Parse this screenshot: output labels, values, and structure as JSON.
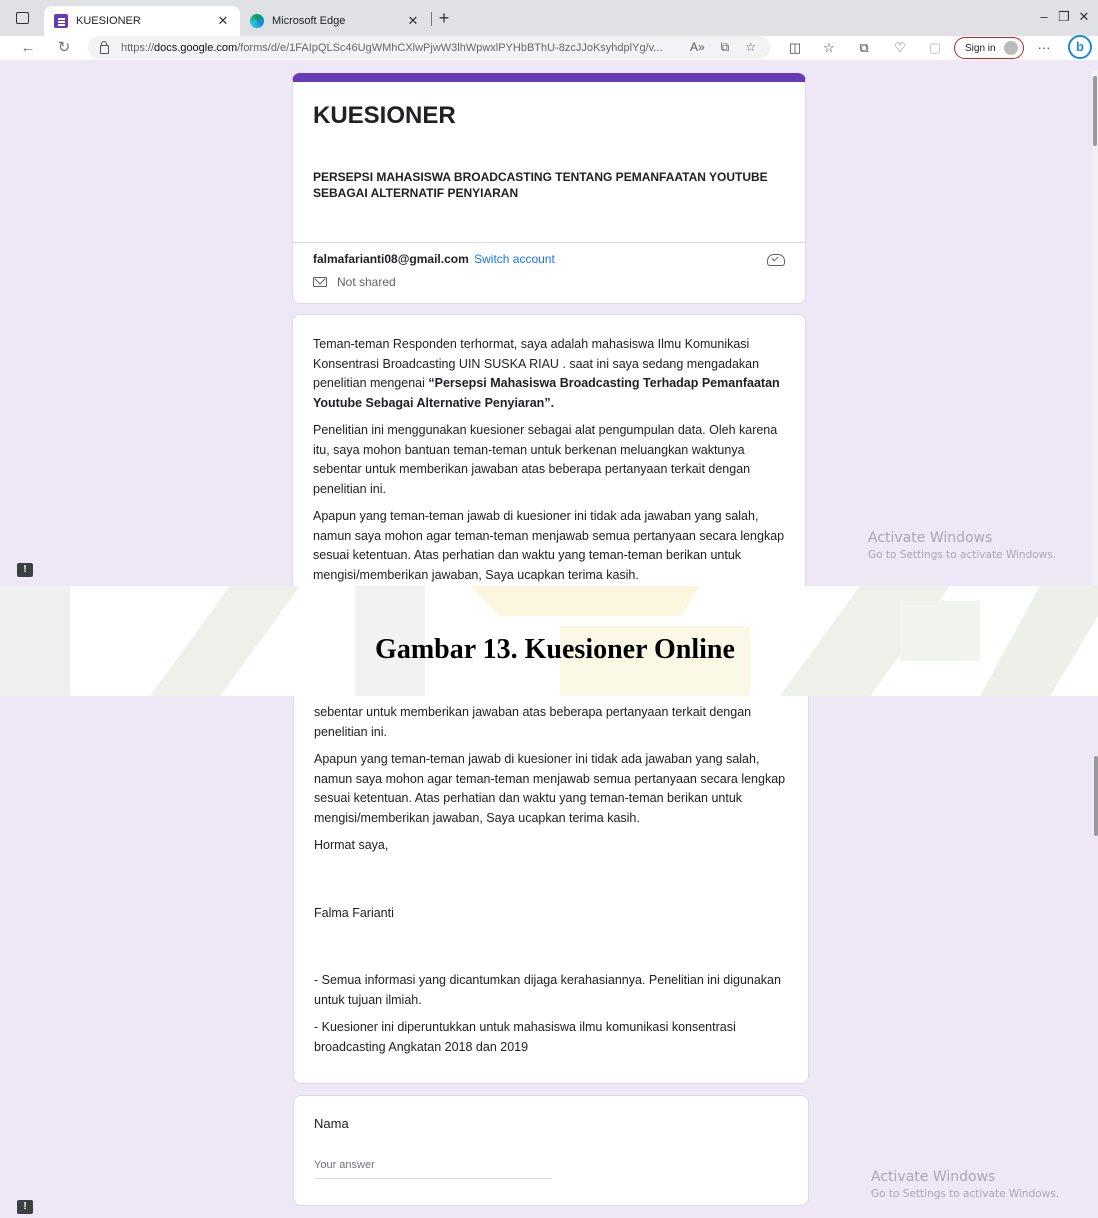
{
  "browser": {
    "tabs": [
      {
        "label": "KUESIONER",
        "close": "✕"
      },
      {
        "label": "Microsoft Edge",
        "close": "✕"
      }
    ],
    "url_prefix": "https://",
    "url_host": "docs.google.com",
    "url_path": "/forms/d/e/1FAIpQLSc46UgWMhCXlwPjwW3lhWpwxlPYHbBThU-8zcJJoKsyhdplYg/v...",
    "sign_in": "Sign in"
  },
  "form": {
    "title": "KUESIONER",
    "subtitle": "PERSEPSI MAHASISWA BROADCASTING TENTANG PEMANFAATAN YOUTUBE SEBAGAI ALTERNATIF PENYIARAN",
    "email": "falmafarianti08@gmail.com",
    "switch_account": "Switch account",
    "not_shared": "Not shared",
    "p1_start": "Teman-teman Responden terhormat, saya adalah mahasiswa Ilmu Komunikasi Konsentrasi Broadcasting UIN SUSKA RIAU . saat ini saya sedang mengadakan penelitian mengenai ",
    "p1_bold": "“Persepsi Mahasiswa Broadcasting Terhadap Pemanfaatan Youtube Sebagai Alternative Penyiaran”.",
    "p2": "Penelitian ini menggunakan kuesioner sebagai alat pengumpulan data. Oleh karena itu, saya mohon bantuan teman-teman untuk berkenan meluangkan waktunya sebentar untuk memberikan jawaban atas beberapa pertanyaan terkait dengan penelitian ini.",
    "p2_tail": "sebentar untuk memberikan jawaban atas beberapa pertanyaan terkait dengan penelitian ini.",
    "p3": "Apapun yang teman-teman jawab di kuesioner ini tidak ada jawaban yang salah, namun saya mohon agar teman-teman menjawab semua pertanyaan secara lengkap sesuai ketentuan. Atas perhatian dan waktu yang teman-teman berikan untuk mengisi/memberikan jawaban, Saya ucapkan terima kasih.",
    "closing": "Hormat saya,",
    "signer": "Falma Farianti",
    "note1": "- Semua informasi yang dicantumkan dijaga kerahasiannya. Penelitian ini digunakan untuk tujuan ilmiah.",
    "note2": "- Kuesioner ini diperuntukkan untuk mahasiswa ilmu komunikasi konsentrasi broadcasting Angkatan 2018 dan 2019",
    "q1_label": "Nama",
    "q1_placeholder": "Your answer"
  },
  "activate_windows": {
    "line1": "Activate Windows",
    "line2": "Go to Settings to activate Windows."
  },
  "caption": "Gambar 13. Kuesioner Online",
  "colors": {
    "accent": "#673ab7",
    "page_bg": "#ede7f6",
    "link": "#1a73e8"
  }
}
